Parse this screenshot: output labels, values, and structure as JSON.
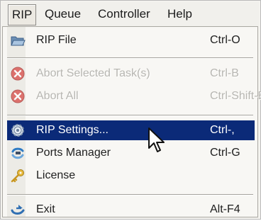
{
  "menubar": {
    "items": [
      "RIP",
      "Queue",
      "Controller",
      "Help"
    ]
  },
  "menu": {
    "items": [
      {
        "label": "RIP File",
        "shortcut": "Ctrl-O",
        "icon": "folder-open-icon",
        "enabled": true
      },
      {
        "label": "Abort Selected Task(s)",
        "shortcut": "Ctrl-B",
        "icon": "abort-icon",
        "enabled": false
      },
      {
        "label": "Abort All",
        "shortcut": "Ctrl-Shift-B",
        "icon": "abort-all-icon",
        "enabled": false
      },
      {
        "label": "RIP Settings...",
        "shortcut": "Ctrl-,",
        "icon": "settings-gear-icon",
        "enabled": true,
        "selected": true
      },
      {
        "label": "Ports Manager",
        "shortcut": "Ctrl-G",
        "icon": "ports-manager-icon",
        "enabled": true
      },
      {
        "label": "License",
        "shortcut": "",
        "icon": "key-icon",
        "enabled": true
      },
      {
        "label": "Exit",
        "shortcut": "Alt-F4",
        "icon": "exit-icon",
        "enabled": true
      }
    ]
  },
  "colors": {
    "selection": "#0b2a78",
    "disabled_text": "#b7b6b1",
    "menu_background": "#f8f7f4"
  }
}
